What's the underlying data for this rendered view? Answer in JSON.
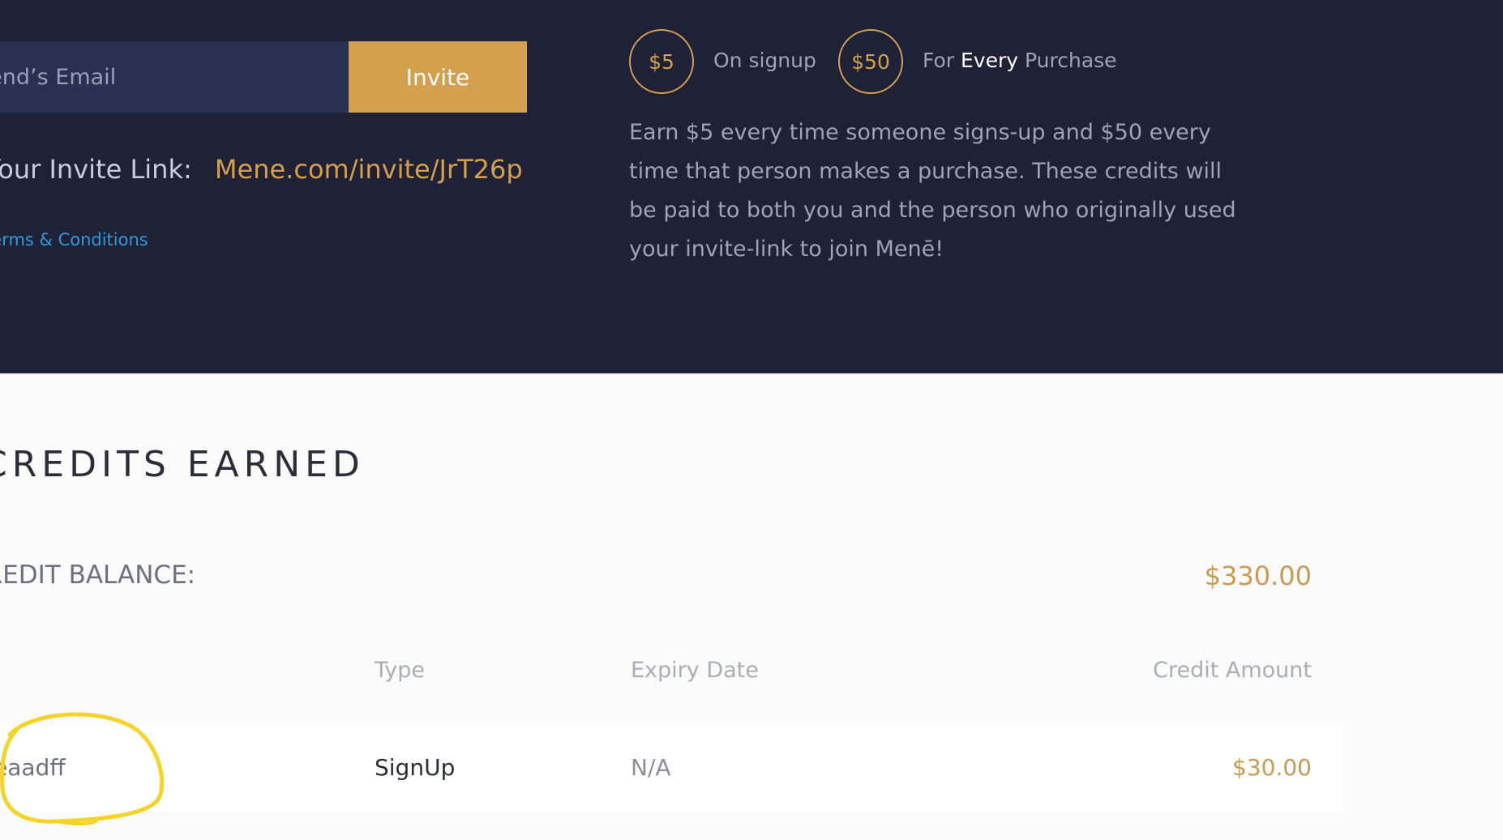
{
  "invite": {
    "email_placeholder": "Friend’s Email",
    "invite_button": "Invite",
    "link_label": "Your Invite Link:",
    "link_url": "Mene.com/invite/JrT26p",
    "terms": "Terms & Conditions"
  },
  "rewards": {
    "signup_amount": "$5",
    "signup_text": "On signup",
    "purchase_amount": "$50",
    "purchase_prefix": "For",
    "purchase_emphasis": "Every",
    "purchase_suffix": "Purchase",
    "description": "Earn $5 every time someone signs-up and $50 every time that person makes a purchase. These credits will be paid to both you and the person who originally used your invite-link to join Menē!"
  },
  "credits": {
    "title": "CREDITS EARNED",
    "balance_label": "CREDIT BALANCE:",
    "balance_value": "$330.00",
    "columns": {
      "type": "Type",
      "expiry": "Expiry Date",
      "amount": "Credit Amount"
    },
    "rows": [
      {
        "code": "eaadff",
        "type": "SignUp",
        "expiry": "N/A",
        "amount": "$30.00"
      }
    ]
  },
  "colors": {
    "dark_bg": "#1f2236",
    "gold": "#d4a04e",
    "link_blue": "#2d9cdb",
    "highlight": "#f5d327"
  }
}
